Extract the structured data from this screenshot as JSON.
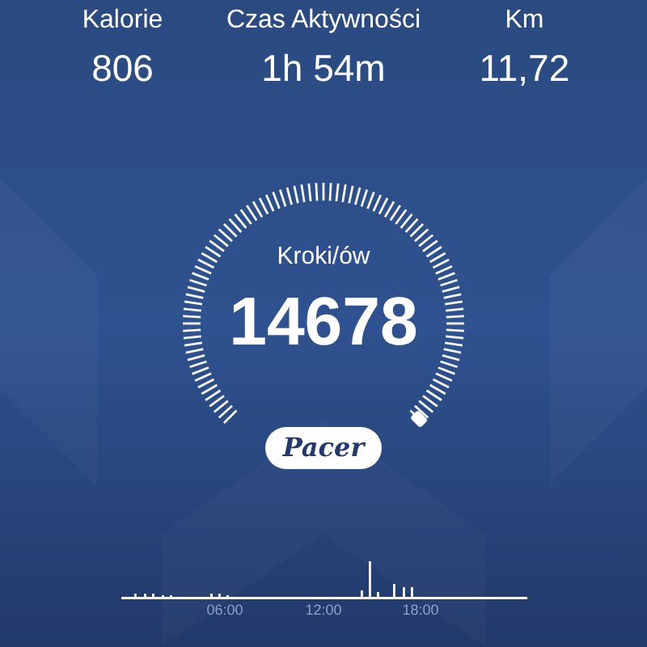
{
  "stats": [
    {
      "label": "Kalorie",
      "value": "806"
    },
    {
      "label": "Czas Aktywności",
      "value": "1h 54m"
    },
    {
      "label": "Km",
      "value": "11,72"
    }
  ],
  "steps": {
    "label": "Kroki/ów",
    "value": "14678"
  },
  "brand_button": {
    "label": "Pacer"
  },
  "activity_chart": {
    "time_labels": [
      "06:00",
      "12:00",
      "18:00"
    ]
  }
}
